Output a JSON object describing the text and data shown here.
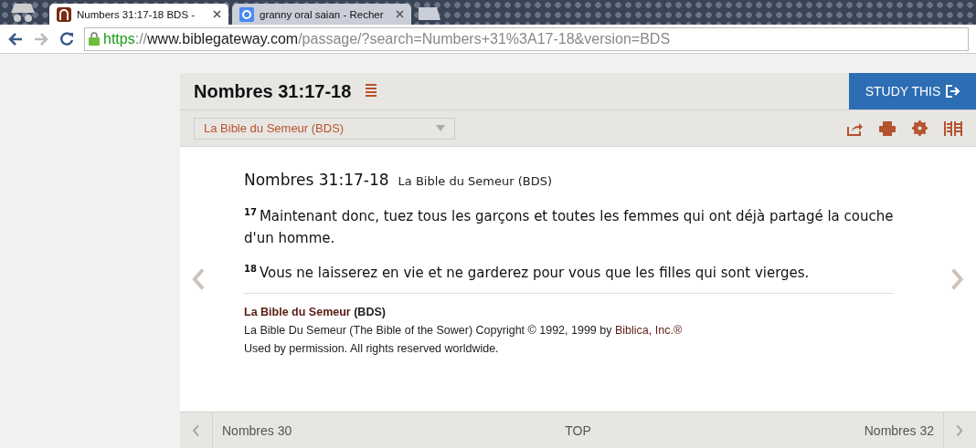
{
  "browser": {
    "tabs": [
      {
        "title": "Numbers 31:17-18 BDS -",
        "kind": "bible",
        "selected": true
      },
      {
        "title": "granny oral saian - Recher",
        "kind": "google",
        "selected": false
      }
    ],
    "url": {
      "scheme": "https",
      "separator": "://",
      "host": "www.biblegateway.com",
      "path": "/passage/?search=Numbers+31%3A17-18&version=BDS"
    }
  },
  "header": {
    "title": "Nombres 31:17-18",
    "study_button": "STUDY THIS",
    "version_select": "La Bible du Semeur (BDS)"
  },
  "passage": {
    "reference": "Nombres 31:17-18",
    "version": "La Bible du Semeur (BDS)",
    "verses": [
      {
        "number": "17",
        "text": "Maintenant donc, tuez tous les garçons et toutes les femmes qui ont déjà partagé la couche d'un homme."
      },
      {
        "number": "18",
        "text": "Vous ne laisserez en vie et ne garderez pour vous que les filles qui sont vierges."
      }
    ],
    "copyright": {
      "name": "La Bible du Semeur",
      "code": "(BDS)",
      "line": "La Bible Du Semeur (The Bible of the Sower) Copyright © 1992, 1999 by",
      "publisher": "Biblica, Inc.®",
      "permission": "Used by permission. All rights reserved worldwide."
    }
  },
  "footer_nav": {
    "previous": "Nombres 30",
    "top": "TOP",
    "next": "Nombres 32"
  }
}
